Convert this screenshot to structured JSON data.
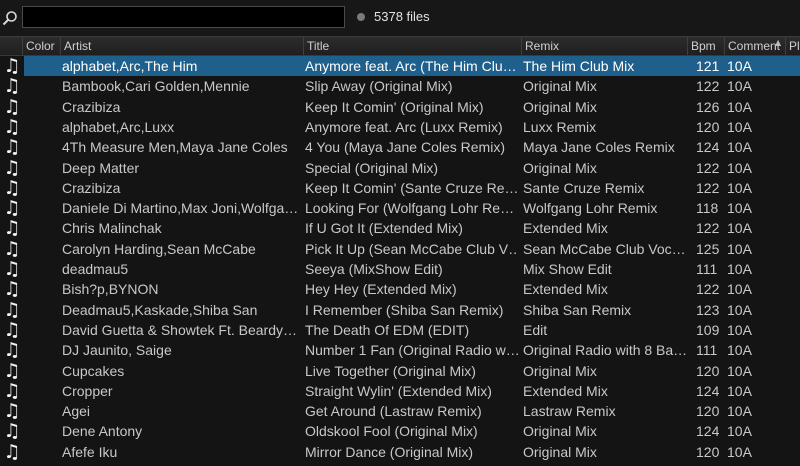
{
  "search": {
    "value": "",
    "placeholder": ""
  },
  "status": {
    "file_count": "5378 files"
  },
  "columns": {
    "color": "Color",
    "artist": "Artist",
    "title": "Title",
    "remix": "Remix",
    "bpm": "Bpm",
    "comment": "Comment",
    "playlist": "Pl"
  },
  "colors": {
    "selected_row": "#1f5f8b",
    "background": "#141414"
  },
  "tracks": [
    {
      "artist": "alphabet,Arc,The Him",
      "title": "Anymore feat. Arc (The Him Clu…",
      "remix": "The Him Club Mix",
      "bpm": "121",
      "comment": "10A",
      "selected": true
    },
    {
      "artist": "Bambook,Cari Golden,Mennie",
      "title": "Slip Away (Original Mix)",
      "remix": "Original Mix",
      "bpm": "122",
      "comment": "10A"
    },
    {
      "artist": "Crazibiza",
      "title": "Keep It Comin' (Original Mix)",
      "remix": "Original Mix",
      "bpm": "126",
      "comment": "10A"
    },
    {
      "artist": "alphabet,Arc,Luxx",
      "title": "Anymore feat. Arc (Luxx Remix)",
      "remix": "Luxx Remix",
      "bpm": "120",
      "comment": "10A"
    },
    {
      "artist": "4Th Measure Men,Maya Jane Coles",
      "title": "4 You (Maya Jane Coles Remix)",
      "remix": "Maya Jane Coles Remix",
      "bpm": "124",
      "comment": "10A"
    },
    {
      "artist": "Deep Matter",
      "title": "Special (Original Mix)",
      "remix": "Original Mix",
      "bpm": "122",
      "comment": "10A"
    },
    {
      "artist": "Crazibiza",
      "title": "Keep It Comin' (Sante Cruze Re…",
      "remix": "Sante Cruze Remix",
      "bpm": "122",
      "comment": "10A"
    },
    {
      "artist": "Daniele Di Martino,Max Joni,Wolfga…",
      "title": "Looking For (Wolfgang Lohr Re…",
      "remix": "Wolfgang Lohr Remix",
      "bpm": "118",
      "comment": "10A"
    },
    {
      "artist": "Chris Malinchak",
      "title": "If U Got It (Extended Mix)",
      "remix": "Extended Mix",
      "bpm": "122",
      "comment": "10A"
    },
    {
      "artist": "Carolyn Harding,Sean McCabe",
      "title": "Pick It Up (Sean McCabe Club V…",
      "remix": "Sean McCabe Club Voc…",
      "bpm": "125",
      "comment": "10A"
    },
    {
      "artist": "deadmau5",
      "title": "Seeya (MixShow Edit)",
      "remix": "Mix Show Edit",
      "bpm": "111",
      "comment": "10A"
    },
    {
      "artist": "Bish?p,BYNON",
      "title": "Hey Hey (Extended Mix)",
      "remix": "Extended Mix",
      "bpm": "122",
      "comment": "10A"
    },
    {
      "artist": "Deadmau5,Kaskade,Shiba San",
      "title": "I Remember (Shiba San Remix)",
      "remix": "Shiba San Remix",
      "bpm": "123",
      "comment": "10A"
    },
    {
      "artist": "David Guetta & Showtek Ft. Beardy…",
      "title": "The Death Of EDM (EDIT)",
      "remix": "Edit",
      "bpm": "109",
      "comment": "10A"
    },
    {
      "artist": "DJ Jaunito, Saige",
      "title": "Number 1 Fan (Original Radio w…",
      "remix": "Original Radio with 8 Ba…",
      "bpm": "111",
      "comment": "10A"
    },
    {
      "artist": "Cupcakes",
      "title": "Live Together (Original Mix)",
      "remix": "Original Mix",
      "bpm": "120",
      "comment": "10A"
    },
    {
      "artist": "Cropper",
      "title": "Straight Wylin' (Extended Mix)",
      "remix": "Extended Mix",
      "bpm": "124",
      "comment": "10A"
    },
    {
      "artist": "Agei",
      "title": "Get Around (Lastraw Remix)",
      "remix": "Lastraw Remix",
      "bpm": "120",
      "comment": "10A"
    },
    {
      "artist": "Dene Antony",
      "title": "Oldskool Fool (Original Mix)",
      "remix": "Original Mix",
      "bpm": "124",
      "comment": "10A"
    },
    {
      "artist": "Afefe Iku",
      "title": "Mirror Dance (Original Mix)",
      "remix": "Original Mix",
      "bpm": "120",
      "comment": "10A"
    }
  ],
  "icons": {
    "search": "search-icon",
    "track": "music-note-icon",
    "status_dot": "dot-icon"
  }
}
